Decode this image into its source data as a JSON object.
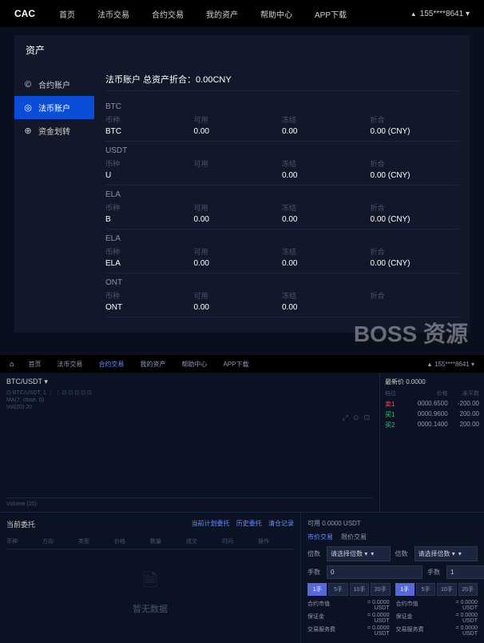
{
  "header": {
    "logo": "CAC",
    "nav": [
      "首页",
      "法币交易",
      "合约交易",
      "我的资产",
      "帮助中心",
      "APP下载"
    ],
    "user": "155****8641"
  },
  "page_title": "资产",
  "sidebar": {
    "items": [
      {
        "label": "合约账户",
        "icon": "©"
      },
      {
        "label": "法币账户",
        "icon": "◎"
      },
      {
        "label": "资金划转",
        "icon": "⊕"
      }
    ]
  },
  "summary": "法币账户 总资产折合：0.00CNY",
  "asset_headers": {
    "c0": "币种",
    "c1": "可用",
    "c2": "冻结",
    "c3": "折合"
  },
  "assets": [
    {
      "title": "BTC",
      "sym": "BTC",
      "avail": "0.00",
      "frozen": "0.00",
      "conv": "0.00 (CNY)"
    },
    {
      "title": "USDT",
      "sym": "U",
      "avail": "",
      "frozen": "0.00",
      "conv": "0.00 (CNY)"
    },
    {
      "title": "ELA",
      "sym": "B",
      "avail": "0.00",
      "frozen": "0.00",
      "conv": "0.00 (CNY)"
    },
    {
      "title": "ELA",
      "sym": "ELA",
      "avail": "0.00",
      "frozen": "0.00",
      "conv": "0.00 (CNY)"
    },
    {
      "title": "ONT",
      "sym": "ONT",
      "avail": "0.00",
      "frozen": "0.00",
      "conv": ""
    }
  ],
  "watermark": "BOSS 资源",
  "header2": {
    "nav": [
      "首页",
      "法币交易",
      "合约交易",
      "我的资产",
      "帮助中心",
      "APP下载"
    ],
    "user": "155****8641"
  },
  "chart": {
    "pair": "BTC/USDT",
    "sub1": "⊡ BTC/USDT, 1 ⋮ ⋮ ⊡ ⊡ ⊡ ⊡ ⊡",
    "sub2": "MA(7, close, 0)",
    "sub3": "Vol(20) 20",
    "footer": "Volume (20)"
  },
  "orderbook": {
    "title": "最新价 0.0000",
    "head": {
      "c0": "档位",
      "c1": "价格",
      "c2": "未平数"
    },
    "rows": [
      {
        "side": "sell",
        "c0": "卖1",
        "c1": "0000.6500",
        "c2": "-200.00"
      },
      {
        "side": "buy",
        "c0": "买1",
        "c1": "0000.9600",
        "c2": "200.00"
      },
      {
        "side": "buy",
        "c0": "买2",
        "c1": "0000.1400",
        "c2": "200.00"
      }
    ]
  },
  "orders": {
    "title": "当前委托",
    "links": [
      "当前计划委托",
      "历史委托",
      "清仓记录"
    ],
    "cols": [
      "币种",
      "方向",
      "类型",
      "价格",
      "数量",
      "成交",
      "时间",
      "操作"
    ],
    "empty": "暂无数据"
  },
  "trade": {
    "avail": "可用 0.0000 USDT",
    "tabs": [
      "市价交易",
      "限价交易"
    ],
    "lbl_lot": "倍数",
    "lbl_lot2": "倍数",
    "sel_lot": "请选择倍数",
    "sel_lot2": "请选择倍数",
    "lbl_qty": "手数",
    "lbl_qty2": "手数",
    "val_qty": "0",
    "val_qty2": "1",
    "btns": [
      "1手",
      "5手",
      "10手",
      "20手"
    ],
    "fees": {
      "f0l": "合约市值",
      "f0v": "= 0.0000 USDT",
      "f1l": "合约市值",
      "f1v": "= 0.0000 USDT",
      "f2l": "保证金",
      "f2v": "= 0.0000 USDT",
      "f3l": "保证金",
      "f3v": "= 0.0000 USDT",
      "f4l": "交易服务费",
      "f4v": "= 0.0000 USDT",
      "f5l": "交易服务费",
      "f5v": "= 0.0000 USDT"
    }
  }
}
